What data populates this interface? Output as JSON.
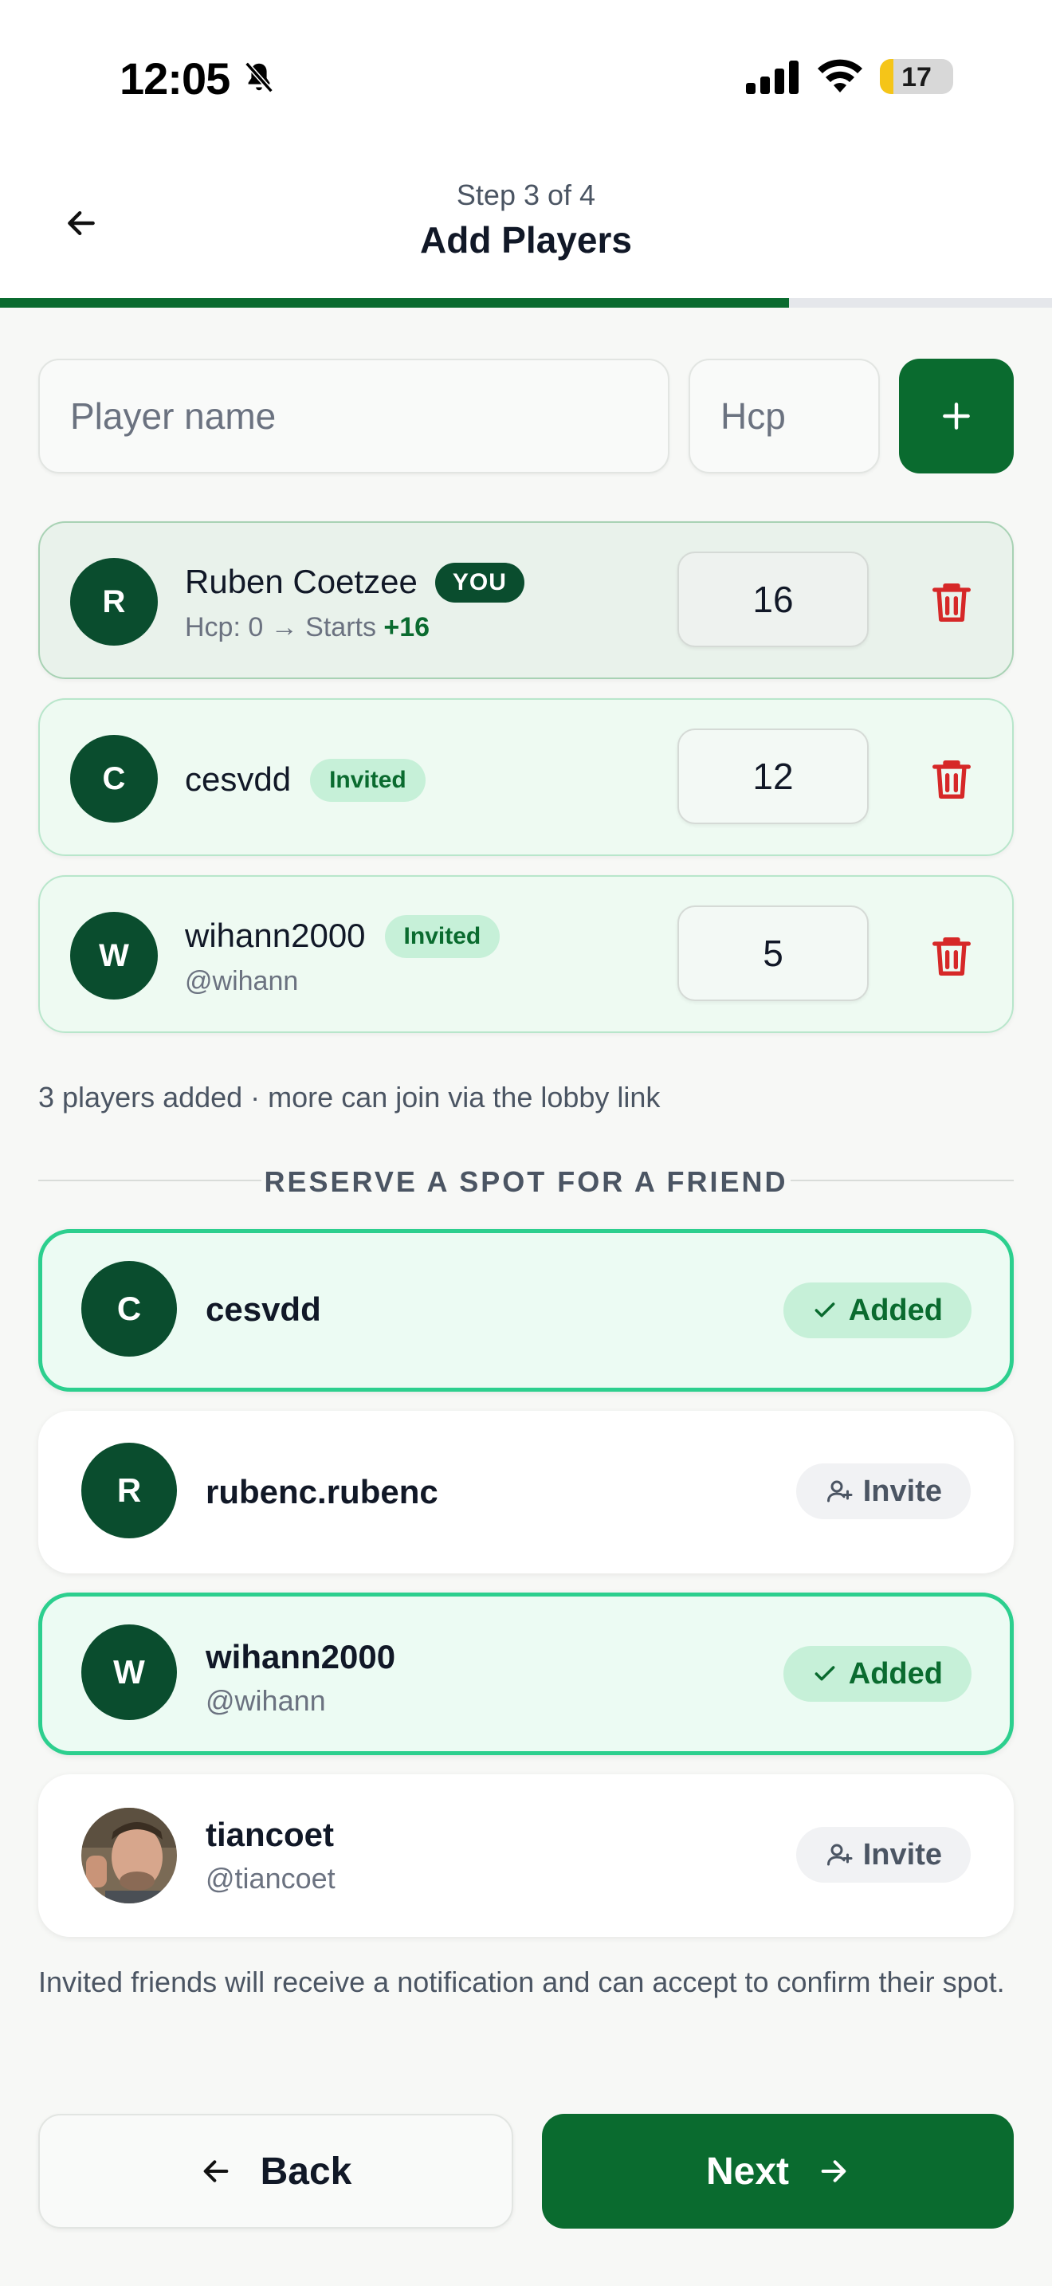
{
  "status_bar": {
    "time": "12:05",
    "battery": "17",
    "icons": [
      "bell-slash-icon",
      "signal-icon",
      "wifi-icon",
      "battery-icon"
    ]
  },
  "header": {
    "step": "Step 3 of 4",
    "title": "Add Players",
    "progress": 0.75,
    "back_icon": "arrow-left-icon"
  },
  "add_form": {
    "name_placeholder": "Player name",
    "hcp_placeholder": "Hcp",
    "add_icon": "plus-icon"
  },
  "players": [
    {
      "initial": "R",
      "name": "Ruben Coetzee",
      "badge": "YOU",
      "sub_prefix": "Hcp: 0 → Starts ",
      "sub_strong": "+16",
      "hcp": "16"
    },
    {
      "initial": "C",
      "name": "cesvdd",
      "badge": "Invited",
      "hcp": "12"
    },
    {
      "initial": "W",
      "name": "wihann2000",
      "badge": "Invited",
      "handle": "@wihann",
      "hcp": "5"
    }
  ],
  "players_note": "3 players added · more can join via the lobby link",
  "reserve_heading": "RESERVE A SPOT FOR A FRIEND",
  "friends": [
    {
      "initial": "C",
      "name": "cesvdd",
      "status": "Added"
    },
    {
      "initial": "R",
      "name": "rubenc.rubenc",
      "status": "Invite"
    },
    {
      "initial": "W",
      "name": "wihann2000",
      "handle": "@wihann",
      "status": "Added"
    },
    {
      "name": "tiancoet",
      "handle": "@tiancoet",
      "status": "Invite",
      "avatar": "photo"
    }
  ],
  "friends_note": "Invited friends will receive a notification and can accept to confirm their spot.",
  "footer": {
    "back_label": "Back",
    "next_label": "Next"
  },
  "colors": {
    "primary": "#0a6b2f",
    "avatar": "#0a4d2e",
    "danger": "#d62828",
    "added_border": "#2ccf8e"
  }
}
